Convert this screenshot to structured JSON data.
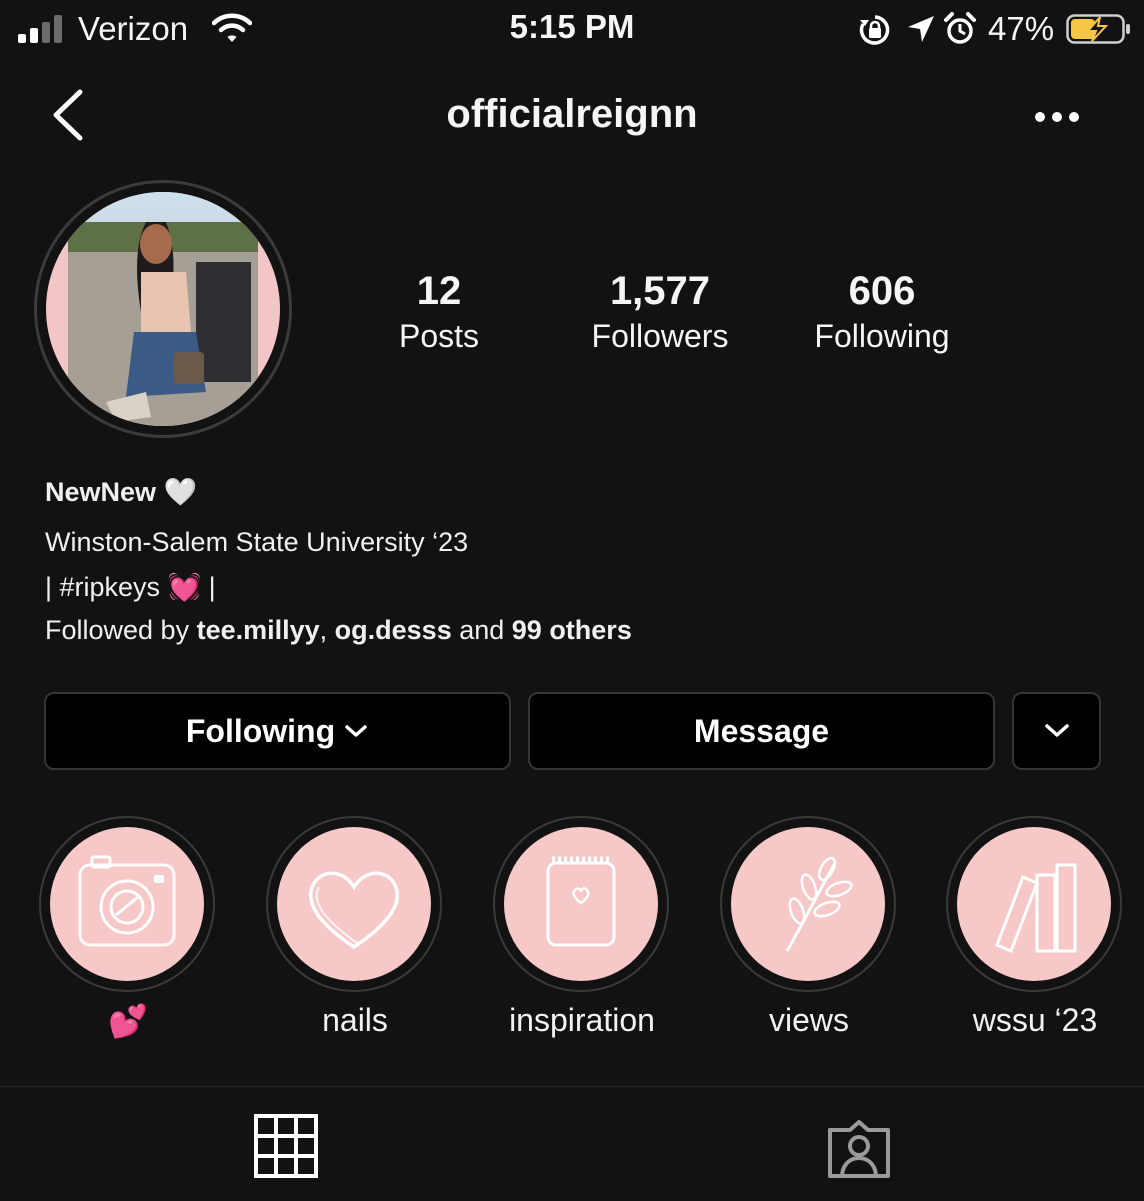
{
  "status_bar": {
    "carrier": "Verizon",
    "time": "5:15 PM",
    "battery_percent": "47%",
    "accent_battery": "#f6c744"
  },
  "header": {
    "username": "officialreignn"
  },
  "stats": {
    "posts": {
      "value": "12",
      "label": "Posts"
    },
    "followers": {
      "value": "1,577",
      "label": "Followers"
    },
    "following": {
      "value": "606",
      "label": "Following"
    }
  },
  "bio": {
    "name": "NewNew 🤍",
    "line1": "Winston-Salem State University ‘23",
    "line2": "| #ripkeys 💓 |",
    "followed_by_prefix": "Followed by ",
    "followed_user1": "tee.millyy",
    "followed_sep": ", ",
    "followed_user2": "og.desss",
    "followed_and": " and ",
    "followed_others": "99 others"
  },
  "buttons": {
    "following_label": "Following",
    "message_label": "Message"
  },
  "highlights": [
    {
      "label": "💕",
      "icon": "camera-icon"
    },
    {
      "label": "nails",
      "icon": "heart-icon"
    },
    {
      "label": "inspiration",
      "icon": "notepad-heart-icon"
    },
    {
      "label": "views",
      "icon": "leaf-icon"
    },
    {
      "label": "wssu ‘23",
      "icon": "books-icon"
    }
  ],
  "colors": {
    "background": "#121212",
    "highlight_fill": "#f6c9c8",
    "button_bg": "#000000"
  }
}
